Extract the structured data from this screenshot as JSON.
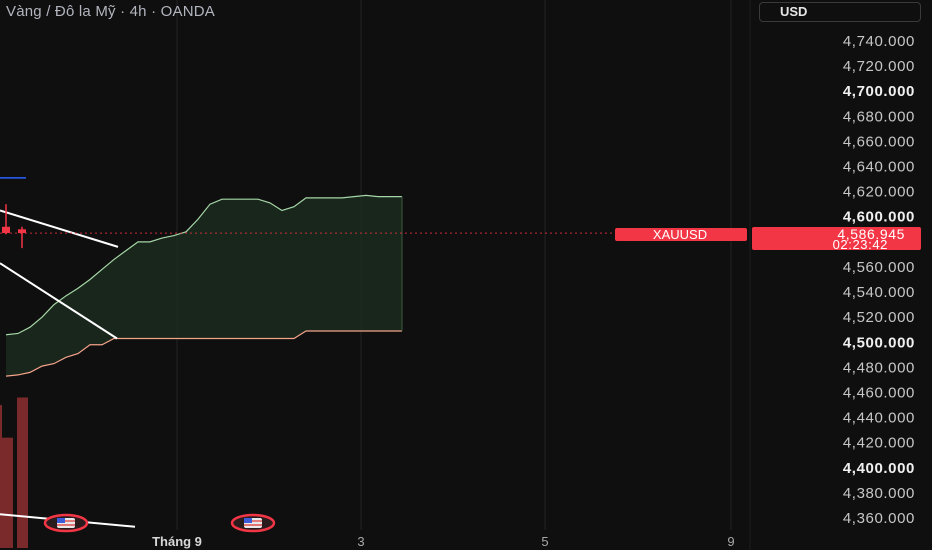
{
  "header": {
    "title": "Vàng / Đô la Mỹ · 4h · OANDA",
    "currency_button": "USD"
  },
  "price_tag": {
    "symbol": "XAUUSD",
    "price": "4,586.945",
    "countdown": "02:23:42"
  },
  "colors": {
    "background": "#0f0f0f",
    "cloud_fill": "#1b2a1f",
    "upper_line": "#a5d6a7",
    "lower_line": "#f4a38a",
    "price_tag": "#f23645",
    "volume": "#7a2a2a",
    "trendline": "#ffffff",
    "event_marker": "#f23645"
  },
  "chart_data": {
    "type": "line",
    "symbol": "XAUUSD",
    "timeframe": "4h",
    "y_axis": {
      "ylim": [
        4350,
        4760
      ],
      "ticks": [
        4740,
        4720,
        4700,
        4680,
        4660,
        4640,
        4620,
        4600,
        4580,
        4560,
        4540,
        4520,
        4500,
        4480,
        4460,
        4440,
        4420,
        4400,
        4380,
        4360
      ],
      "tick_labels": [
        "4,740.000",
        "4,720.000",
        "4,700.000",
        "4,680.000",
        "4,660.000",
        "4,640.000",
        "4,620.000",
        "4,600.000",
        "4,580.000",
        "4,560.000",
        "4,540.000",
        "4,520.000",
        "4,500.000",
        "4,480.000",
        "4,460.000",
        "4,440.000",
        "4,420.000",
        "4,400.000",
        "4,380.000",
        "4,360.000"
      ],
      "bold_ticks": [
        4700,
        4600,
        4500,
        4400
      ]
    },
    "x_axis": {
      "ticks": [
        {
          "label": "Tháng 9",
          "bold": true
        },
        {
          "label": "3",
          "bold": false
        },
        {
          "label": "5",
          "bold": false
        },
        {
          "label": "9",
          "bold": false
        }
      ]
    },
    "last_price": 4586.945,
    "cloud_upper": [
      4506,
      4507,
      4512,
      4520,
      4530,
      4537,
      4543,
      4550,
      4558,
      4566,
      4573,
      4580,
      4580,
      4583,
      4585,
      4588,
      4598,
      4610,
      4614,
      4614,
      4614,
      4614,
      4611,
      4605,
      4608,
      4615,
      4615,
      4615,
      4615,
      4616,
      4617,
      4616,
      4616,
      4616
    ],
    "cloud_lower": [
      4473,
      4474,
      4476,
      4481,
      4483,
      4488,
      4491,
      4498,
      4498,
      4503,
      4503,
      4503,
      4503,
      4503,
      4503,
      4503,
      4503,
      4503,
      4503,
      4503,
      4503,
      4503,
      4503,
      4503,
      4503,
      4509,
      4509,
      4509,
      4509,
      4509,
      4509,
      4509,
      4509,
      4509
    ],
    "candles": [
      {
        "open": 4592,
        "high": 4610,
        "low": 4586,
        "close": 4587
      },
      {
        "open": 4590,
        "high": 4592,
        "low": 4575,
        "close": 4587
      }
    ],
    "volumes": [
      4424,
      4456
    ],
    "blue_line_level": 4631,
    "trendlines": [
      {
        "from": 4605,
        "to": 4576
      },
      {
        "from": 4563,
        "to": 4503
      },
      {
        "from": 4363,
        "to": 4353
      }
    ],
    "event_markers": 2
  }
}
